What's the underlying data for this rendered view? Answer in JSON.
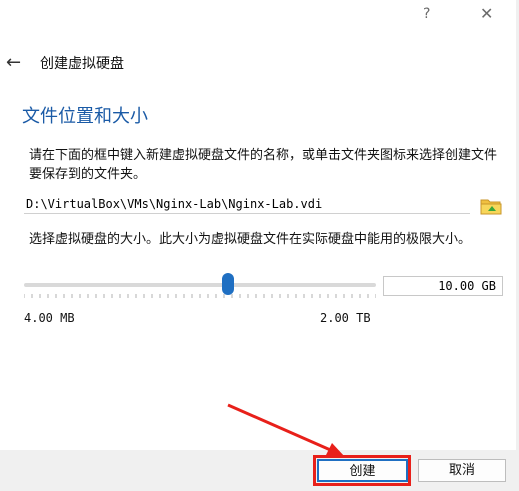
{
  "titlebar": {
    "help_label": "?",
    "close_label": "✕"
  },
  "wizard": {
    "back_label": "←",
    "title": "创建虚拟硬盘"
  },
  "section": {
    "title": "文件位置和大小"
  },
  "location": {
    "description": "请在下面的框中键入新建虚拟硬盘文件的名称，或单击文件夹图标来选择创建文件要保存到的文件夹。",
    "path_value": "D:\\VirtualBox\\VMs\\Nginx-Lab\\Nginx-Lab.vdi",
    "folder_icon": "folder-open-icon"
  },
  "size": {
    "description": "选择虚拟硬盘的大小。此大小为虚拟硬盘文件在实际硬盘中能用的极限大小。",
    "value_text": "10.00 GB",
    "slider_fraction": 0.58,
    "min_label": "4.00 MB",
    "max_label": "2.00 TB"
  },
  "footer": {
    "create_label": "创建",
    "cancel_label": "取消"
  },
  "colors": {
    "accent": "#1f6fc2",
    "title_blue": "#1a5aa6",
    "annotation_red": "#e8201a"
  }
}
